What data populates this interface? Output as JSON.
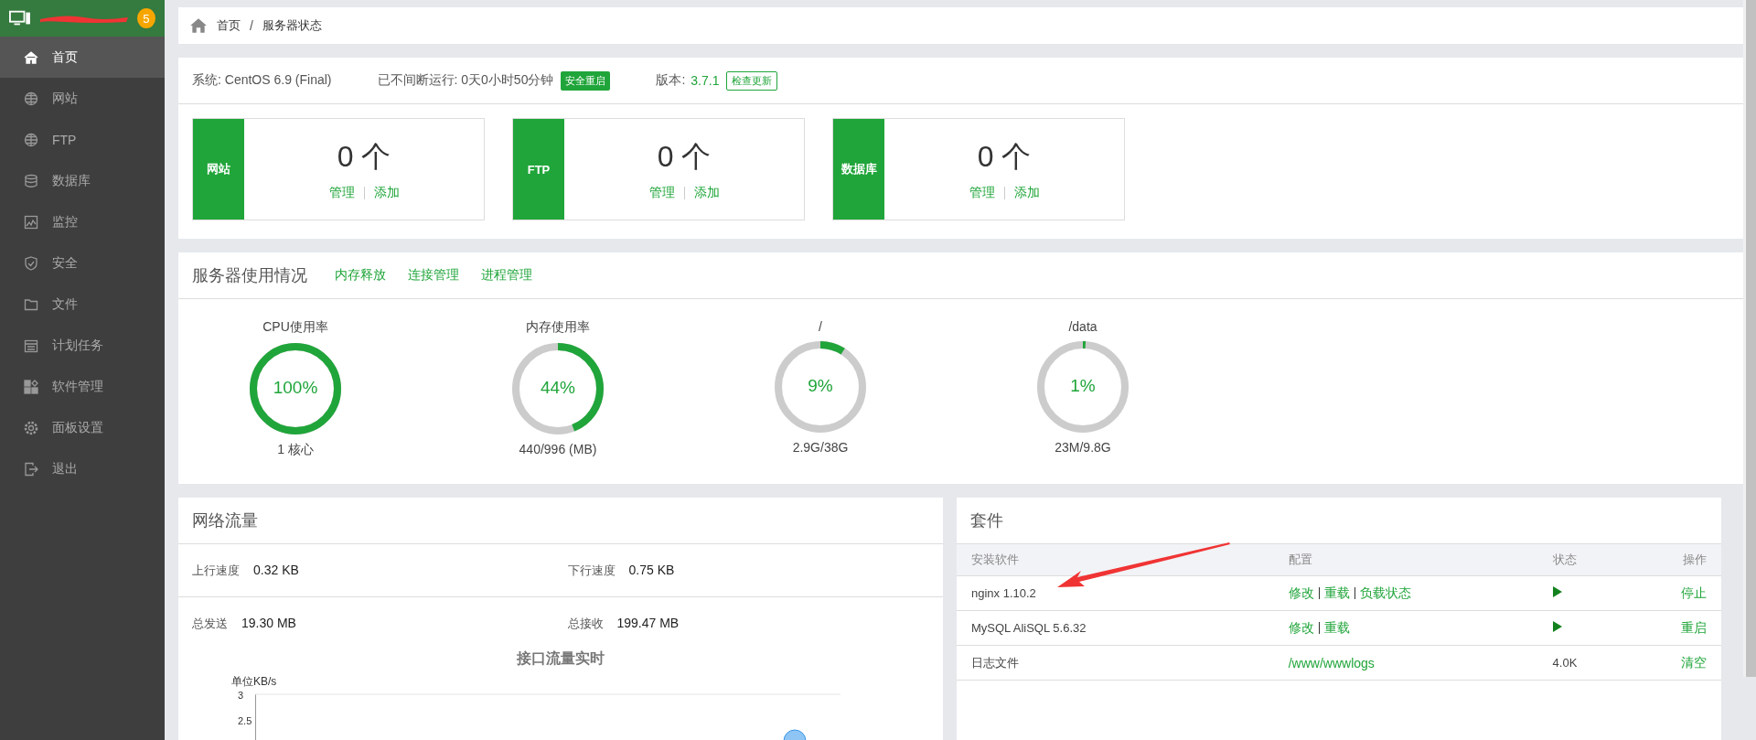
{
  "header": {
    "badge": "5"
  },
  "sidebar": {
    "items": [
      {
        "label": "首页",
        "selected": true
      },
      {
        "label": "网站",
        "selected": false
      },
      {
        "label": "FTP",
        "selected": false
      },
      {
        "label": "数据库",
        "selected": false
      },
      {
        "label": "监控",
        "selected": false
      },
      {
        "label": "安全",
        "selected": false
      },
      {
        "label": "文件",
        "selected": false
      },
      {
        "label": "计划任务",
        "selected": false
      },
      {
        "label": "软件管理",
        "selected": false
      },
      {
        "label": "面板设置",
        "selected": false
      },
      {
        "label": "退出",
        "selected": false
      }
    ]
  },
  "breadcrumb": {
    "items": [
      "首页",
      "服务器状态"
    ],
    "separator": "/"
  },
  "system": {
    "os": "系统: CentOS 6.9 (Final)",
    "uptime": "已不间断运行: 0天0小时50分钟",
    "restart_button": "安全重启",
    "version_label": "版本:",
    "version": "3.7.1",
    "update_button": "检查更新"
  },
  "stat_cards": [
    {
      "label": "网站",
      "count": "0 个",
      "links": [
        "管理",
        "添加"
      ]
    },
    {
      "label": "FTP",
      "count": "0 个",
      "links": [
        "管理",
        "添加"
      ]
    },
    {
      "label": "数据库",
      "count": "0 个",
      "links": [
        "管理",
        "添加"
      ]
    }
  ],
  "usage": {
    "title": "服务器使用情况",
    "links": [
      "内存释放",
      "连接管理",
      "进程管理"
    ],
    "gauges": [
      {
        "title": "CPU使用率",
        "value": "100%",
        "level": 1.0,
        "detail": "1 核心"
      },
      {
        "title": "内存使用率",
        "value": "44%",
        "level": 0.44,
        "detail": "440/996 (MB)"
      },
      {
        "title": "/",
        "value": "9%",
        "level": 0.09,
        "detail": "2.9G/38G"
      },
      {
        "title": "/data",
        "value": "1%",
        "level": 0.01,
        "detail": "23M/9.8G"
      }
    ]
  },
  "network": {
    "title": "网络流量",
    "stats": [
      {
        "label": "上行速度",
        "value": "0.32 KB"
      },
      {
        "label": "下行速度",
        "value": "0.75 KB"
      },
      {
        "label": "总发送",
        "value": "19.30 MB"
      },
      {
        "label": "总接收",
        "value": "199.47 MB"
      }
    ],
    "chart": {
      "title": "接口流量实时",
      "unit": "单位KB/s",
      "tick_labels": [
        "3",
        "2.5"
      ]
    }
  },
  "packages": {
    "title": "套件",
    "columns": [
      "安装软件",
      "配置",
      "状态",
      "操作"
    ],
    "rows": [
      {
        "name": "nginx 1.10.2",
        "config": [
          "修改",
          "重载",
          "负载状态"
        ],
        "kind": "running",
        "action": "停止"
      },
      {
        "name": "MySQL AliSQL 5.6.32",
        "config": [
          "修改",
          "重载"
        ],
        "kind": "running",
        "action": "重启"
      },
      {
        "name": "日志文件",
        "config": [
          "/www/wwwlogs"
        ],
        "kind": "text",
        "status": "4.0K",
        "action": "清空"
      }
    ]
  }
}
